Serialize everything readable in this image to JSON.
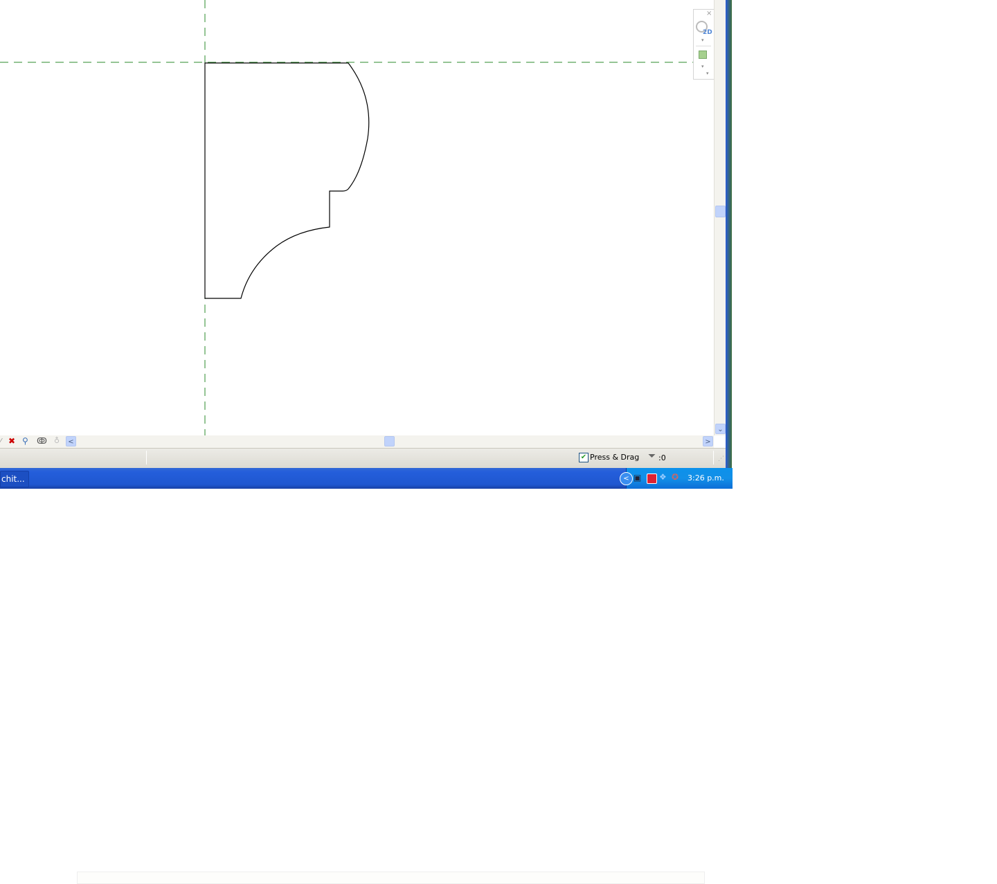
{
  "status_bar": {
    "press_drag_label": "Press & Drag",
    "press_drag_checked": true,
    "filter_count": ":0"
  },
  "taskbar": {
    "app_button_label": "chit...",
    "clock": "3:26 p.m."
  },
  "navigation_bar": {
    "close": "×",
    "view_label": "2D"
  },
  "icons": [
    "close-icon",
    "2d-wheel-icon",
    "zoom-region-icon",
    "chevron-down-icon",
    "filter-icon",
    "checkbox-icon",
    "scroll-left-icon",
    "scroll-right-icon",
    "scroll-down-icon",
    "tray-network-icon",
    "tray-security-icon",
    "tray-dropbox-icon",
    "tray-sound-icon"
  ],
  "scroll_arrows": {
    "left": "<",
    "right": ">",
    "down": "⌄"
  }
}
